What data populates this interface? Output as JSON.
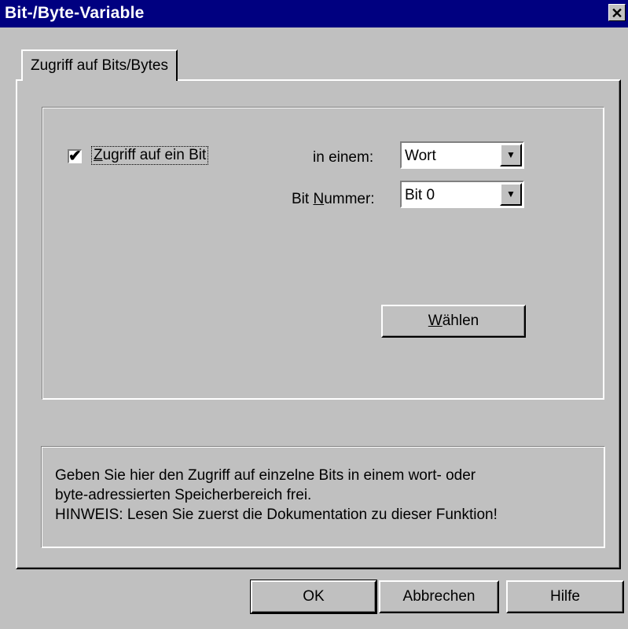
{
  "window": {
    "title": "Bit-/Byte-Variable",
    "close_glyph": "✕"
  },
  "tabs": [
    {
      "label": "Zugriff auf Bits/Bytes"
    }
  ],
  "access": {
    "checkbox_checked": true,
    "checkbox_glyph": "✔",
    "checkbox_label_pre": "",
    "checkbox_label_mnemonic": "Z",
    "checkbox_label_post": "ugriff auf ein Bit",
    "in_label": "in einem:",
    "in_value": "Wort",
    "bitnum_label_pre": "Bit ",
    "bitnum_label_mnemonic": "N",
    "bitnum_label_post": "ummer:",
    "bitnum_value": "Bit 0",
    "select_button_mnemonic": "W",
    "select_button_rest": "ählen"
  },
  "info": {
    "lines": [
      "Geben Sie hier den Zugriff auf einzelne Bits in einem wort- oder",
      "byte-adressierten Speicherbereich frei.",
      "HINWEIS: Lesen Sie zuerst die Dokumentation zu dieser Funktion!"
    ]
  },
  "buttons": {
    "ok": "OK",
    "cancel": "Abbrechen",
    "help": "Hilfe"
  },
  "colors": {
    "titlebar": "#000080",
    "face": "#c0c0c0"
  }
}
